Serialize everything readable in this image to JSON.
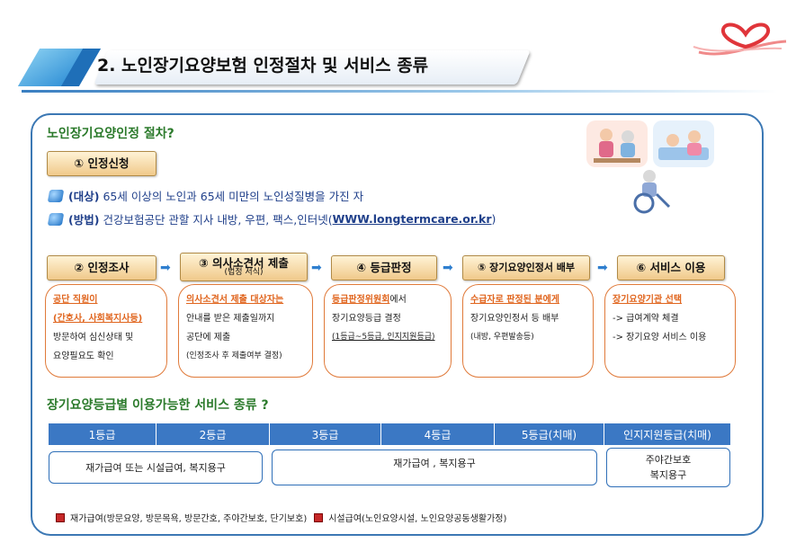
{
  "header": {
    "title": "2. 노인장기요양보험 인정절차 및 서비스 종류"
  },
  "procedure": {
    "section_title": "노인장기요양인정 절차?",
    "step1_label": "① 인정신청",
    "target_label": "(대상)",
    "target_text": "65세 이상의 노인과 65세 미만의 노인성질병을 가진 자",
    "method_label": "(방법)",
    "method_text": "건강보험공단 관할 지사 내방, 우편, 팩스,인터넷(",
    "method_url": "WWW.longtermcare.or.kr",
    "method_close": ")",
    "steps": [
      {
        "label": "② 인정조사",
        "sub": ""
      },
      {
        "label": "③ 의사소견서 제출",
        "sub": "(법정 서식)"
      },
      {
        "label": "④ 등급판정",
        "sub": ""
      },
      {
        "label": "⑤ 장기요양인정서 배부",
        "sub": ""
      },
      {
        "label": "⑥ 서비스 이용",
        "sub": ""
      }
    ],
    "arrow_symbol": "➡",
    "cards": [
      {
        "lines": [
          "공단 직원이",
          "(간호사, 사회복지사등)",
          "방문하여 심신상태 및",
          "요양필요도 확인"
        ]
      },
      {
        "lines": [
          "의사소견서 제출 대상자는",
          "안내를 받은 제출일까지",
          "공단에 제출",
          "(인정조사 후 제출여부 결정)"
        ]
      },
      {
        "lines": [
          "등급판정위원회",
          "에서",
          "장기요양등급 결정",
          "(1등급~5등급, 인지지원등급)"
        ]
      },
      {
        "lines": [
          "수급자로 판정된 분에게",
          "장기요양인정서 등 배부",
          "(내방, 우편발송등)"
        ]
      },
      {
        "lines": [
          "장기요양기관 선택",
          "-> 급여계약 체결",
          "-> 장기요양 서비스 이용"
        ]
      }
    ]
  },
  "grades": {
    "section_title": "장기요양등급별 이용가능한 서비스 종류 ?",
    "columns": [
      "1등급",
      "2등급",
      "3등급",
      "4등급",
      "5등급(치매)",
      "인지지원등급(치매)"
    ],
    "box1": "재가급여 또는 시설급여, 복지용구",
    "box2": "재가급여 , 복지용구",
    "box3_line1": "주야간보호",
    "box3_line2": "복지용구"
  },
  "legend": {
    "item1": "재가급여(방문요양, 방문목욕, 방문간호, 주야간보호, 단기보호)",
    "item2": "시설급여(노인요양시설, 노인요양공동생활가정)"
  },
  "colors": {
    "accent_blue": "#3b78c4",
    "section_green": "#2b7a2b",
    "card_orange": "#e07a3a",
    "pill_gold": "#f0c98a",
    "legend_red": "#c62828"
  },
  "icons": [
    "heart-ribbon-icon",
    "bullet-cube-icon",
    "arrow-right-icon",
    "legend-square-icon"
  ]
}
